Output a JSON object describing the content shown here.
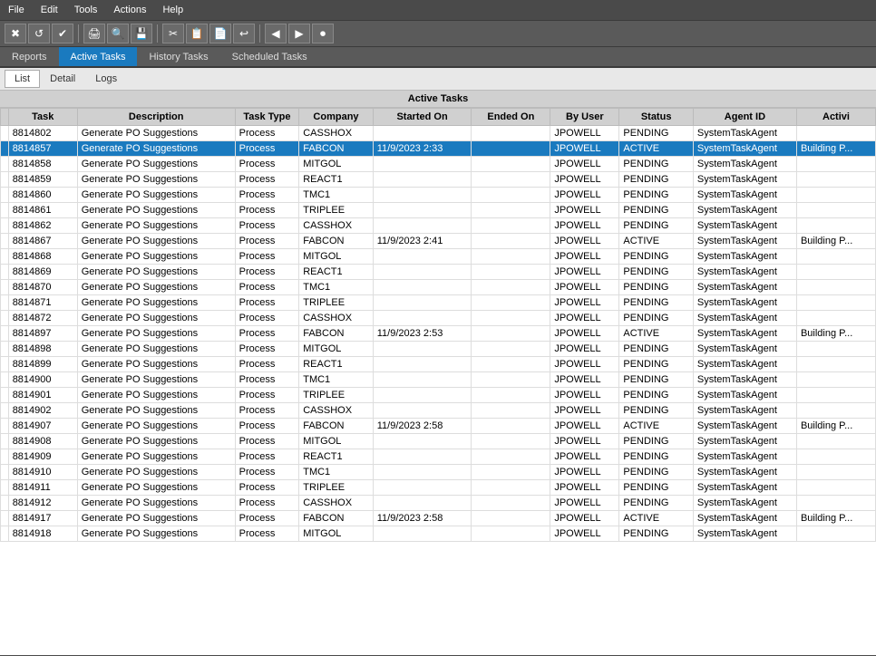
{
  "menu": {
    "items": [
      "File",
      "Edit",
      "Tools",
      "Actions",
      "Help"
    ]
  },
  "toolbar": {
    "buttons": [
      "✖",
      "↺",
      "✔",
      "🖨",
      "🔍",
      "💾",
      "✂",
      "📋",
      "📄",
      "↩",
      "◀",
      "▶",
      "⏺"
    ]
  },
  "tabs": [
    {
      "id": "reports",
      "label": "Reports",
      "active": false
    },
    {
      "id": "active-tasks",
      "label": "Active Tasks",
      "active": true
    },
    {
      "id": "history-tasks",
      "label": "History Tasks",
      "active": false
    },
    {
      "id": "scheduled-tasks",
      "label": "Scheduled Tasks",
      "active": false
    }
  ],
  "sub_tabs": [
    {
      "id": "list",
      "label": "List",
      "active": true
    },
    {
      "id": "detail",
      "label": "Detail",
      "active": false
    },
    {
      "id": "logs",
      "label": "Logs",
      "active": false
    }
  ],
  "panel_title": "Active Tasks",
  "columns": [
    {
      "id": "indicator",
      "label": ""
    },
    {
      "id": "task",
      "label": "Task"
    },
    {
      "id": "description",
      "label": "Description"
    },
    {
      "id": "task_type",
      "label": "Task Type"
    },
    {
      "id": "company",
      "label": "Company"
    },
    {
      "id": "started_on",
      "label": "Started On"
    },
    {
      "id": "ended_on",
      "label": "Ended On"
    },
    {
      "id": "by_user",
      "label": "By User"
    },
    {
      "id": "status",
      "label": "Status"
    },
    {
      "id": "agent_id",
      "label": "Agent ID"
    },
    {
      "id": "activi",
      "label": "Activi"
    }
  ],
  "rows": [
    {
      "task": "8814802",
      "description": "Generate PO Suggestions",
      "task_type": "Process",
      "company": "CASSHOX",
      "started_on": "",
      "ended_on": "",
      "by_user": "JPOWELL",
      "status": "PENDING",
      "agent_id": "SystemTaskAgent",
      "activi": "",
      "selected": false,
      "indicator": false
    },
    {
      "task": "8814857",
      "description": "Generate PO Suggestions",
      "task_type": "Process",
      "company": "FABCON",
      "started_on": "11/9/2023 2:33",
      "ended_on": "",
      "by_user": "JPOWELL",
      "status": "ACTIVE",
      "agent_id": "SystemTaskAgent",
      "activi": "Building P...",
      "selected": true,
      "indicator": true
    },
    {
      "task": "8814858",
      "description": "Generate PO Suggestions",
      "task_type": "Process",
      "company": "MITGOL",
      "started_on": "",
      "ended_on": "",
      "by_user": "JPOWELL",
      "status": "PENDING",
      "agent_id": "SystemTaskAgent",
      "activi": "",
      "selected": false,
      "indicator": false
    },
    {
      "task": "8814859",
      "description": "Generate PO Suggestions",
      "task_type": "Process",
      "company": "REACT1",
      "started_on": "",
      "ended_on": "",
      "by_user": "JPOWELL",
      "status": "PENDING",
      "agent_id": "SystemTaskAgent",
      "activi": "",
      "selected": false,
      "indicator": false
    },
    {
      "task": "8814860",
      "description": "Generate PO Suggestions",
      "task_type": "Process",
      "company": "TMC1",
      "started_on": "",
      "ended_on": "",
      "by_user": "JPOWELL",
      "status": "PENDING",
      "agent_id": "SystemTaskAgent",
      "activi": "",
      "selected": false,
      "indicator": false
    },
    {
      "task": "8814861",
      "description": "Generate PO Suggestions",
      "task_type": "Process",
      "company": "TRIPLEE",
      "started_on": "",
      "ended_on": "",
      "by_user": "JPOWELL",
      "status": "PENDING",
      "agent_id": "SystemTaskAgent",
      "activi": "",
      "selected": false,
      "indicator": false
    },
    {
      "task": "8814862",
      "description": "Generate PO Suggestions",
      "task_type": "Process",
      "company": "CASSHOX",
      "started_on": "",
      "ended_on": "",
      "by_user": "JPOWELL",
      "status": "PENDING",
      "agent_id": "SystemTaskAgent",
      "activi": "",
      "selected": false,
      "indicator": false
    },
    {
      "task": "8814867",
      "description": "Generate PO Suggestions",
      "task_type": "Process",
      "company": "FABCON",
      "started_on": "11/9/2023 2:41",
      "ended_on": "",
      "by_user": "JPOWELL",
      "status": "ACTIVE",
      "agent_id": "SystemTaskAgent",
      "activi": "Building P...",
      "selected": false,
      "indicator": false
    },
    {
      "task": "8814868",
      "description": "Generate PO Suggestions",
      "task_type": "Process",
      "company": "MITGOL",
      "started_on": "",
      "ended_on": "",
      "by_user": "JPOWELL",
      "status": "PENDING",
      "agent_id": "SystemTaskAgent",
      "activi": "",
      "selected": false,
      "indicator": false
    },
    {
      "task": "8814869",
      "description": "Generate PO Suggestions",
      "task_type": "Process",
      "company": "REACT1",
      "started_on": "",
      "ended_on": "",
      "by_user": "JPOWELL",
      "status": "PENDING",
      "agent_id": "SystemTaskAgent",
      "activi": "",
      "selected": false,
      "indicator": false
    },
    {
      "task": "8814870",
      "description": "Generate PO Suggestions",
      "task_type": "Process",
      "company": "TMC1",
      "started_on": "",
      "ended_on": "",
      "by_user": "JPOWELL",
      "status": "PENDING",
      "agent_id": "SystemTaskAgent",
      "activi": "",
      "selected": false,
      "indicator": false
    },
    {
      "task": "8814871",
      "description": "Generate PO Suggestions",
      "task_type": "Process",
      "company": "TRIPLEE",
      "started_on": "",
      "ended_on": "",
      "by_user": "JPOWELL",
      "status": "PENDING",
      "agent_id": "SystemTaskAgent",
      "activi": "",
      "selected": false,
      "indicator": false
    },
    {
      "task": "8814872",
      "description": "Generate PO Suggestions",
      "task_type": "Process",
      "company": "CASSHOX",
      "started_on": "",
      "ended_on": "",
      "by_user": "JPOWELL",
      "status": "PENDING",
      "agent_id": "SystemTaskAgent",
      "activi": "",
      "selected": false,
      "indicator": false
    },
    {
      "task": "8814897",
      "description": "Generate PO Suggestions",
      "task_type": "Process",
      "company": "FABCON",
      "started_on": "11/9/2023 2:53",
      "ended_on": "",
      "by_user": "JPOWELL",
      "status": "ACTIVE",
      "agent_id": "SystemTaskAgent",
      "activi": "Building P...",
      "selected": false,
      "indicator": false
    },
    {
      "task": "8814898",
      "description": "Generate PO Suggestions",
      "task_type": "Process",
      "company": "MITGOL",
      "started_on": "",
      "ended_on": "",
      "by_user": "JPOWELL",
      "status": "PENDING",
      "agent_id": "SystemTaskAgent",
      "activi": "",
      "selected": false,
      "indicator": false
    },
    {
      "task": "8814899",
      "description": "Generate PO Suggestions",
      "task_type": "Process",
      "company": "REACT1",
      "started_on": "",
      "ended_on": "",
      "by_user": "JPOWELL",
      "status": "PENDING",
      "agent_id": "SystemTaskAgent",
      "activi": "",
      "selected": false,
      "indicator": false
    },
    {
      "task": "8814900",
      "description": "Generate PO Suggestions",
      "task_type": "Process",
      "company": "TMC1",
      "started_on": "",
      "ended_on": "",
      "by_user": "JPOWELL",
      "status": "PENDING",
      "agent_id": "SystemTaskAgent",
      "activi": "",
      "selected": false,
      "indicator": false
    },
    {
      "task": "8814901",
      "description": "Generate PO Suggestions",
      "task_type": "Process",
      "company": "TRIPLEE",
      "started_on": "",
      "ended_on": "",
      "by_user": "JPOWELL",
      "status": "PENDING",
      "agent_id": "SystemTaskAgent",
      "activi": "",
      "selected": false,
      "indicator": false
    },
    {
      "task": "8814902",
      "description": "Generate PO Suggestions",
      "task_type": "Process",
      "company": "CASSHOX",
      "started_on": "",
      "ended_on": "",
      "by_user": "JPOWELL",
      "status": "PENDING",
      "agent_id": "SystemTaskAgent",
      "activi": "",
      "selected": false,
      "indicator": false
    },
    {
      "task": "8814907",
      "description": "Generate PO Suggestions",
      "task_type": "Process",
      "company": "FABCON",
      "started_on": "11/9/2023 2:58",
      "ended_on": "",
      "by_user": "JPOWELL",
      "status": "ACTIVE",
      "agent_id": "SystemTaskAgent",
      "activi": "Building P...",
      "selected": false,
      "indicator": false
    },
    {
      "task": "8814908",
      "description": "Generate PO Suggestions",
      "task_type": "Process",
      "company": "MITGOL",
      "started_on": "",
      "ended_on": "",
      "by_user": "JPOWELL",
      "status": "PENDING",
      "agent_id": "SystemTaskAgent",
      "activi": "",
      "selected": false,
      "indicator": false
    },
    {
      "task": "8814909",
      "description": "Generate PO Suggestions",
      "task_type": "Process",
      "company": "REACT1",
      "started_on": "",
      "ended_on": "",
      "by_user": "JPOWELL",
      "status": "PENDING",
      "agent_id": "SystemTaskAgent",
      "activi": "",
      "selected": false,
      "indicator": false
    },
    {
      "task": "8814910",
      "description": "Generate PO Suggestions",
      "task_type": "Process",
      "company": "TMC1",
      "started_on": "",
      "ended_on": "",
      "by_user": "JPOWELL",
      "status": "PENDING",
      "agent_id": "SystemTaskAgent",
      "activi": "",
      "selected": false,
      "indicator": false
    },
    {
      "task": "8814911",
      "description": "Generate PO Suggestions",
      "task_type": "Process",
      "company": "TRIPLEE",
      "started_on": "",
      "ended_on": "",
      "by_user": "JPOWELL",
      "status": "PENDING",
      "agent_id": "SystemTaskAgent",
      "activi": "",
      "selected": false,
      "indicator": false
    },
    {
      "task": "8814912",
      "description": "Generate PO Suggestions",
      "task_type": "Process",
      "company": "CASSHOX",
      "started_on": "",
      "ended_on": "",
      "by_user": "JPOWELL",
      "status": "PENDING",
      "agent_id": "SystemTaskAgent",
      "activi": "",
      "selected": false,
      "indicator": false
    },
    {
      "task": "8814917",
      "description": "Generate PO Suggestions",
      "task_type": "Process",
      "company": "FABCON",
      "started_on": "11/9/2023 2:58",
      "ended_on": "",
      "by_user": "JPOWELL",
      "status": "ACTIVE",
      "agent_id": "SystemTaskAgent",
      "activi": "Building P...",
      "selected": false,
      "indicator": false
    },
    {
      "task": "8814918",
      "description": "Generate PO Suggestions",
      "task_type": "Process",
      "company": "MITGOL",
      "started_on": "",
      "ended_on": "",
      "by_user": "JPOWELL",
      "status": "PENDING",
      "agent_id": "SystemTaskAgent",
      "activi": "",
      "selected": false,
      "indicator": false
    }
  ]
}
